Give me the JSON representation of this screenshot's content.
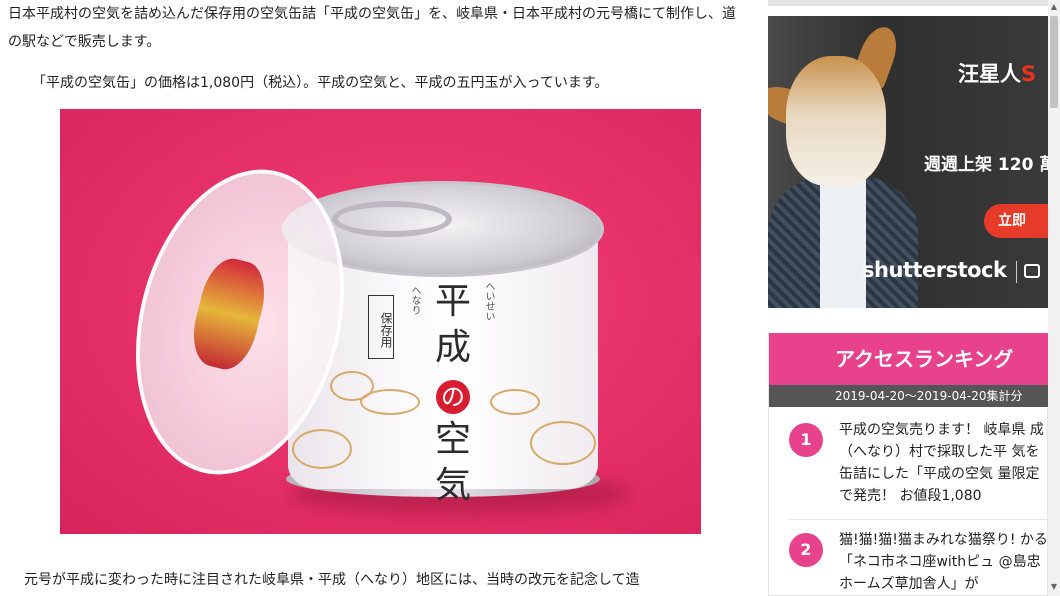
{
  "article": {
    "paragraph1": "日本平成村の空気を詰め込んだ保存用の空気缶詰「平成の空気缶」を、岐阜県・日本平成村の元号橋にて制作し、道の駅などで販売します。",
    "paragraph2": "「平成の空気缶」の価格は1,080円（税込）。平成の空気と、平成の五円玉が入っています。",
    "paragraph3": "元号が平成に変わった時に注目された岐阜県・平成（へなり）地区には、当時の改元を記念して造",
    "photo": {
      "label_title_1": "平成",
      "label_title_no": "の",
      "label_title_2": "空気",
      "label_ruby_heisei": "へいせい",
      "label_ruby_henari": "へなり",
      "label_box": "保存用"
    }
  },
  "sidebar": {
    "ad": {
      "brand_prefix": "汪星人",
      "brand_suffix": "S",
      "subtitle": "週週上架 120 萬",
      "button_label": "立即",
      "logo": "shutterstock"
    },
    "ranking": {
      "title": "アクセスランキング",
      "date_range": "2019-04-20〜2019-04-20集計分",
      "items": [
        {
          "rank": "1",
          "text": "平成の空気売ります！ 岐阜県 成（へなり）村で採取した平 気を缶詰にした「平成の空気 量限定で発売！ お値段1,080"
        },
        {
          "rank": "2",
          "text": "猫!猫!猫!猫まみれな猫祭り! かる「ネコ市ネコ座withピュ @島忠ホームズ草加舎人」が"
        }
      ]
    }
  },
  "colors": {
    "accent_pink": "#e8428c",
    "photo_background": "#e7336a",
    "ad_button": "#e73b2a"
  }
}
